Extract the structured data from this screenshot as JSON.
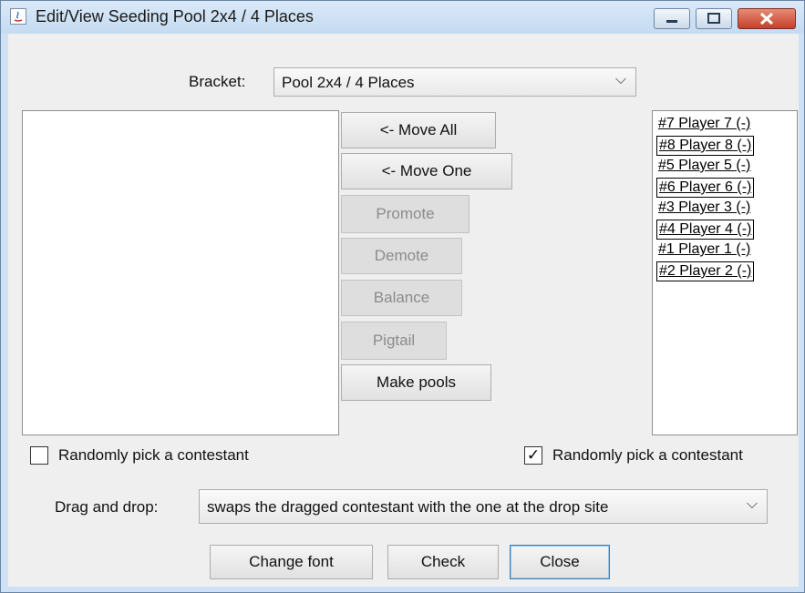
{
  "window": {
    "title": "Edit/View Seeding Pool 2x4 / 4 Places"
  },
  "bracket": {
    "label": "Bracket:",
    "selected": "Pool 2x4 / 4 Places"
  },
  "buttons": {
    "move_all": "<- Move All",
    "move_one": "<- Move One",
    "promote": "Promote",
    "demote": "Demote",
    "balance": "Balance",
    "pigtail": "Pigtail",
    "make_pools": "Make pools"
  },
  "seeded_list": [
    {
      "label": "#7 Player 7 (-)",
      "boxed": false
    },
    {
      "label": "#8 Player 8 (-)",
      "boxed": true
    },
    {
      "label": "#5 Player 5 (-)",
      "boxed": false
    },
    {
      "label": "#6 Player 6 (-)",
      "boxed": true
    },
    {
      "label": "#3 Player 3 (-)",
      "boxed": false
    },
    {
      "label": "#4 Player 4 (-)",
      "boxed": true
    },
    {
      "label": "#1 Player 1 (-)",
      "boxed": false
    },
    {
      "label": "#2 Player 2 (-)",
      "boxed": true
    }
  ],
  "random_left": {
    "label": "Randomly pick a contestant",
    "checked": false
  },
  "random_right": {
    "label": "Randomly pick a contestant",
    "checked": true,
    "check_glyph": "✓"
  },
  "drag_drop": {
    "label": "Drag and drop:",
    "selected": "swaps the dragged contestant with the one at the drop site"
  },
  "footer": {
    "change_font": "Change font",
    "check": "Check",
    "close": "Close"
  },
  "icons": {
    "dropdown_arrow": "⌵",
    "minimize": "minimize-icon",
    "maximize": "maximize-icon",
    "close": "close-icon"
  }
}
